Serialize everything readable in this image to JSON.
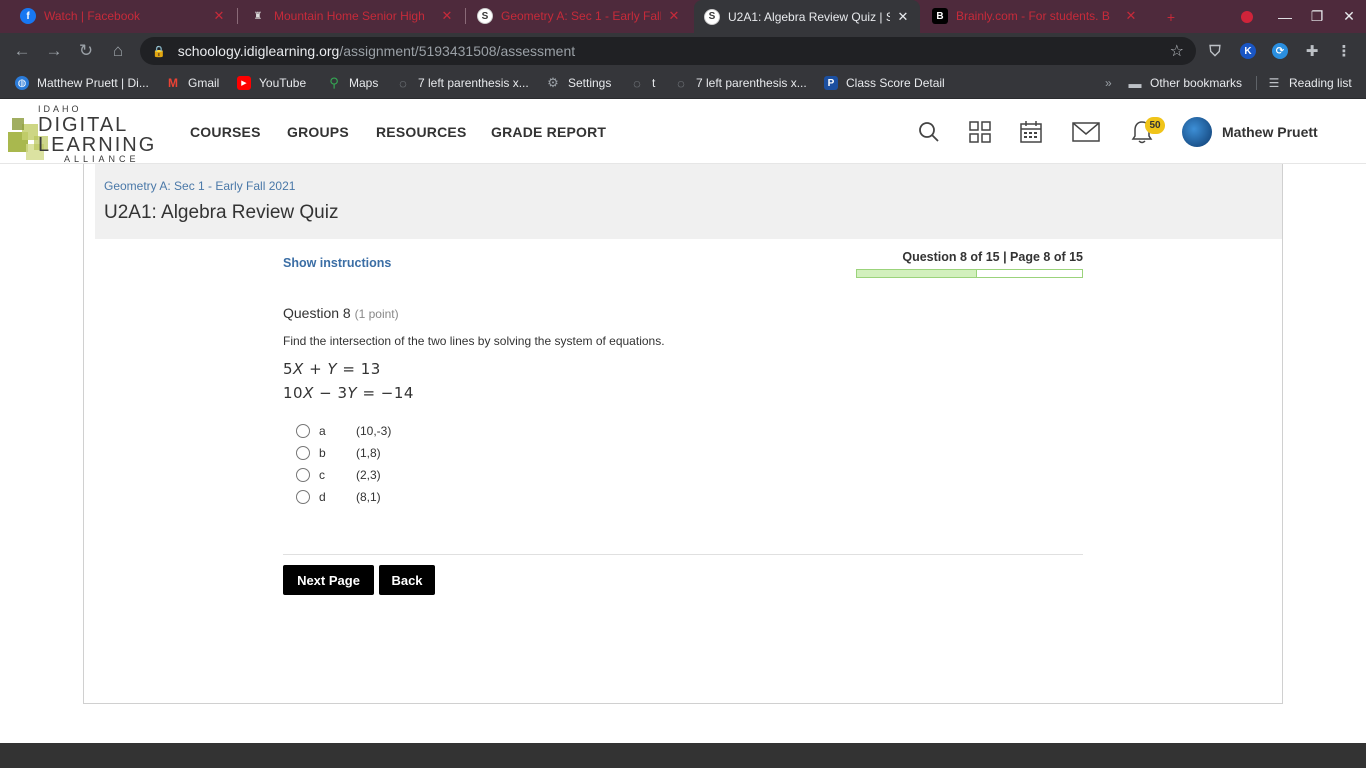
{
  "browser": {
    "tabs": [
      {
        "title": "Watch | Facebook",
        "icon": "facebook-icon",
        "active": false
      },
      {
        "title": "Mountain Home Senior High",
        "icon": "school-icon",
        "active": false
      },
      {
        "title": "Geometry A: Sec 1 - Early Fall",
        "icon": "schoology-icon",
        "active": false
      },
      {
        "title": "U2A1: Algebra Review Quiz | S",
        "icon": "schoology-icon",
        "active": true
      },
      {
        "title": "Brainly.com - For students. B",
        "icon": "brainly-icon",
        "active": false
      }
    ],
    "url_host": "schoology.idiglearning.org",
    "url_path": "/assignment/5193431508/assessment",
    "bookmarks": [
      {
        "label": "Matthew Pruett | Di...",
        "icon": "globe-icon"
      },
      {
        "label": "Gmail",
        "icon": "gmail-icon"
      },
      {
        "label": "YouTube",
        "icon": "youtube-icon"
      },
      {
        "label": "Maps",
        "icon": "maps-icon"
      },
      {
        "label": "7 left parenthesis x...",
        "icon": "globe-icon"
      },
      {
        "label": "Settings",
        "icon": "gear-icon"
      },
      {
        "label": "t",
        "icon": "globe-icon"
      },
      {
        "label": "7 left parenthesis x...",
        "icon": "globe-icon"
      },
      {
        "label": "Class Score Detail",
        "icon": "powerschool-icon"
      }
    ],
    "other_bookmarks": "Other bookmarks",
    "reading_list": "Reading list"
  },
  "site": {
    "logo_lines": [
      "IDAHO",
      "DIGITAL",
      "LEARNING",
      "ALLIANCE"
    ],
    "nav": [
      "COURSES",
      "GROUPS",
      "RESOURCES",
      "GRADE REPORT"
    ],
    "notification_count": "50",
    "user_name": "Mathew Pruett"
  },
  "page": {
    "breadcrumb": "Geometry A: Sec 1 - Early Fall 2021",
    "title": "U2A1: Algebra Review Quiz",
    "show_instructions": "Show instructions",
    "question_counter": "Question 8 of 15 | Page 8 of 15",
    "progress_fraction": 0.533,
    "question_label": "Question 8",
    "question_points": "(1 point)",
    "question_text": "Find the intersection of the two lines by solving the system of equations.",
    "equations": [
      {
        "parts": [
          "5",
          "X",
          " + ",
          "Y",
          " = 13"
        ]
      },
      {
        "parts": [
          "10",
          "X",
          " − 3",
          "Y",
          " = −14"
        ]
      }
    ],
    "choices": [
      {
        "letter": "a",
        "value": "(10,-3)"
      },
      {
        "letter": "b",
        "value": "(1,8)"
      },
      {
        "letter": "c",
        "value": "(2,3)"
      },
      {
        "letter": "d",
        "value": "(8,1)"
      }
    ],
    "next_button": "Next Page",
    "back_button": "Back"
  },
  "colors": {
    "tabbar": "#4e2a3c",
    "link": "#3b6ea5",
    "progress_fill": "#d2f0bd",
    "badge": "#f0c419"
  }
}
